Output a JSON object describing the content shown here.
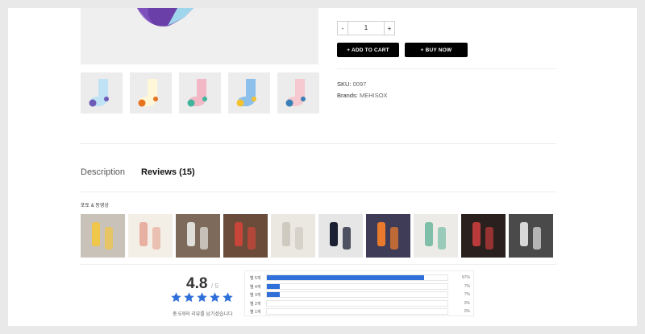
{
  "product": {
    "quantity": {
      "decrement": "-",
      "value": "1",
      "increment": "+"
    },
    "add_to_cart_label": "+ ADD TO CART",
    "buy_now_label": "+ BUY NOW",
    "sku_label": "SKU:",
    "sku_value": "0097",
    "brands_label": "Brands:",
    "brands_value": "MEHISOX",
    "thumbnails": [
      {
        "name": "sock-light-blue",
        "color": "#bfe3f5",
        "toe": "#6d5bb8"
      },
      {
        "name": "sock-orange-cream",
        "color": "#fff7d8",
        "toe": "#e8731f"
      },
      {
        "name": "sock-teal-pink",
        "color": "#f2b8c6",
        "toe": "#3fb59c"
      },
      {
        "name": "sock-blue-yellow",
        "color": "#8cc0ea",
        "toe": "#f2c230"
      },
      {
        "name": "sock-pink-blue",
        "color": "#f6c8d0",
        "toe": "#3a7fb5"
      }
    ]
  },
  "tabs": [
    {
      "label": "Description",
      "active": false
    },
    {
      "label": "Reviews (15)",
      "active": true
    }
  ],
  "reviews": {
    "media_section_title": "포토 & 동영상",
    "photos": [
      {
        "bg": "#c9c2b8",
        "fg": "#f0c64b"
      },
      {
        "bg": "#f3efe7",
        "fg": "#e7b0a0"
      },
      {
        "bg": "#7d6a5a",
        "fg": "#e0ded8"
      },
      {
        "bg": "#6b4b3a",
        "fg": "#c8453a"
      },
      {
        "bg": "#ebe8e2",
        "fg": "#cfcac0"
      },
      {
        "bg": "#e6e6e6",
        "fg": "#1b2033"
      },
      {
        "bg": "#3e3c57",
        "fg": "#ea7a2b"
      },
      {
        "bg": "#ecebe7",
        "fg": "#7fbfa9"
      },
      {
        "bg": "#2a201e",
        "fg": "#b83a3a"
      },
      {
        "bg": "#4a4a4a",
        "fg": "#d8d8d8"
      }
    ],
    "score": "4.8",
    "score_max": "/ 5",
    "stars": 5,
    "star_color": "#2f6fd9",
    "note": "총 5개의 리뷰를 남기셨습니다",
    "distribution": [
      {
        "label": "별 5개",
        "percent": 87,
        "percent_label": "87%"
      },
      {
        "label": "별 4개",
        "percent": 7,
        "percent_label": "7%"
      },
      {
        "label": "별 3개",
        "percent": 7,
        "percent_label": "7%"
      },
      {
        "label": "별 2개",
        "percent": 0,
        "percent_label": "0%"
      },
      {
        "label": "별 1개",
        "percent": 0,
        "percent_label": "0%"
      }
    ]
  }
}
